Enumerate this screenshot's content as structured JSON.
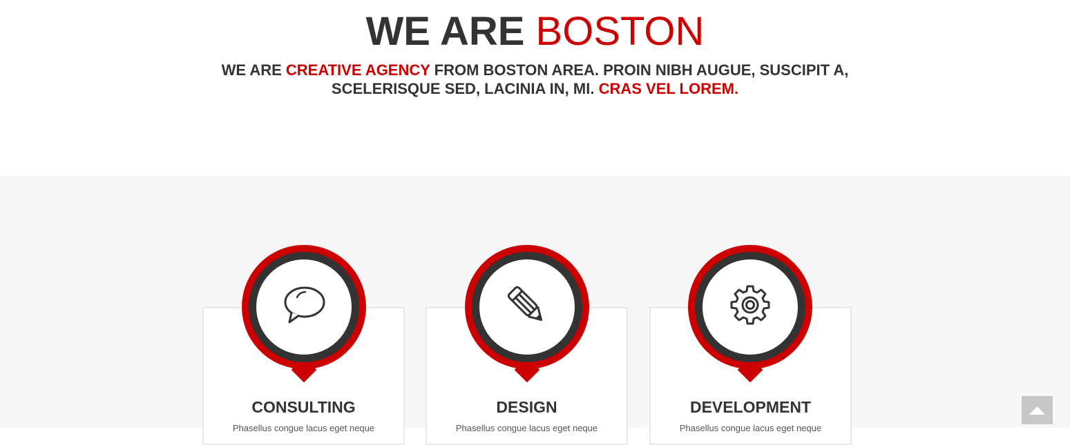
{
  "hero": {
    "title_dark": "WE ARE",
    "title_red": "BOSTON",
    "subtitle_parts": {
      "p1": "WE ARE ",
      "p2_red": "CREATIVE AGENCY",
      "p3": " FROM BOSTON AREA. PROIN NIBH AUGUE, SUSCIPIT A,",
      "p4": "SCELERISQUE SED, LACINIA IN, MI. ",
      "p5_red": "CRAS VEL LOREM."
    }
  },
  "services": [
    {
      "title": "CONSULTING",
      "description": "Phasellus congue lacus eget neque",
      "icon": "speech-bubble-icon"
    },
    {
      "title": "DESIGN",
      "description": "Phasellus congue lacus eget neque",
      "icon": "pencil-icon"
    },
    {
      "title": "DEVELOPMENT",
      "description": "Phasellus congue lacus eget neque",
      "icon": "gear-icon"
    }
  ],
  "scroll_top": {
    "icon": "arrow-up-icon"
  },
  "colors": {
    "accent": "#cc0000",
    "dark": "#333333",
    "section_bg": "#f7f7f7"
  }
}
